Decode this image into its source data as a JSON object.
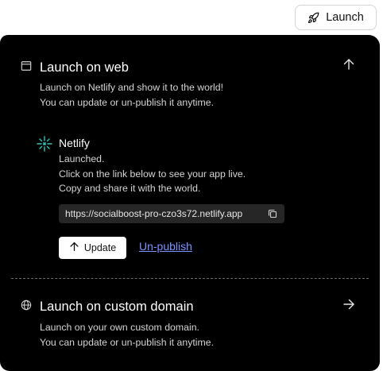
{
  "header": {
    "launch_label": "Launch",
    "launch_icon": "rocket-icon"
  },
  "web_section": {
    "title": "Launch on web",
    "icon": "browser-window-icon",
    "desc_line1": "Launch on Netlify and show it to the world!",
    "desc_line2": "You can update or un-publish it anytime.",
    "collapse_icon": "arrow-up-icon"
  },
  "netlify": {
    "name": "Netlify",
    "status_line1": "Launched.",
    "status_line2": "Click on the link below to see your app live.",
    "status_line3": "Copy and share it with the world.",
    "url": "https://socialboost-pro-czo3s72.netlify.app",
    "copy_icon": "copy-icon",
    "update_label": "Update",
    "unpublish_label": "Un-publish"
  },
  "domain_section": {
    "title": "Launch on custom domain",
    "icon": "globe-icon",
    "desc_line1": "Launch on your own custom domain.",
    "desc_line2": "You can update or un-publish it anytime.",
    "expand_icon": "arrow-right-icon"
  },
  "colors": {
    "panel_bg": "#000000",
    "link": "#7c93ff",
    "url_box_bg": "#262626",
    "netlify_teal": "#32c3b4"
  }
}
